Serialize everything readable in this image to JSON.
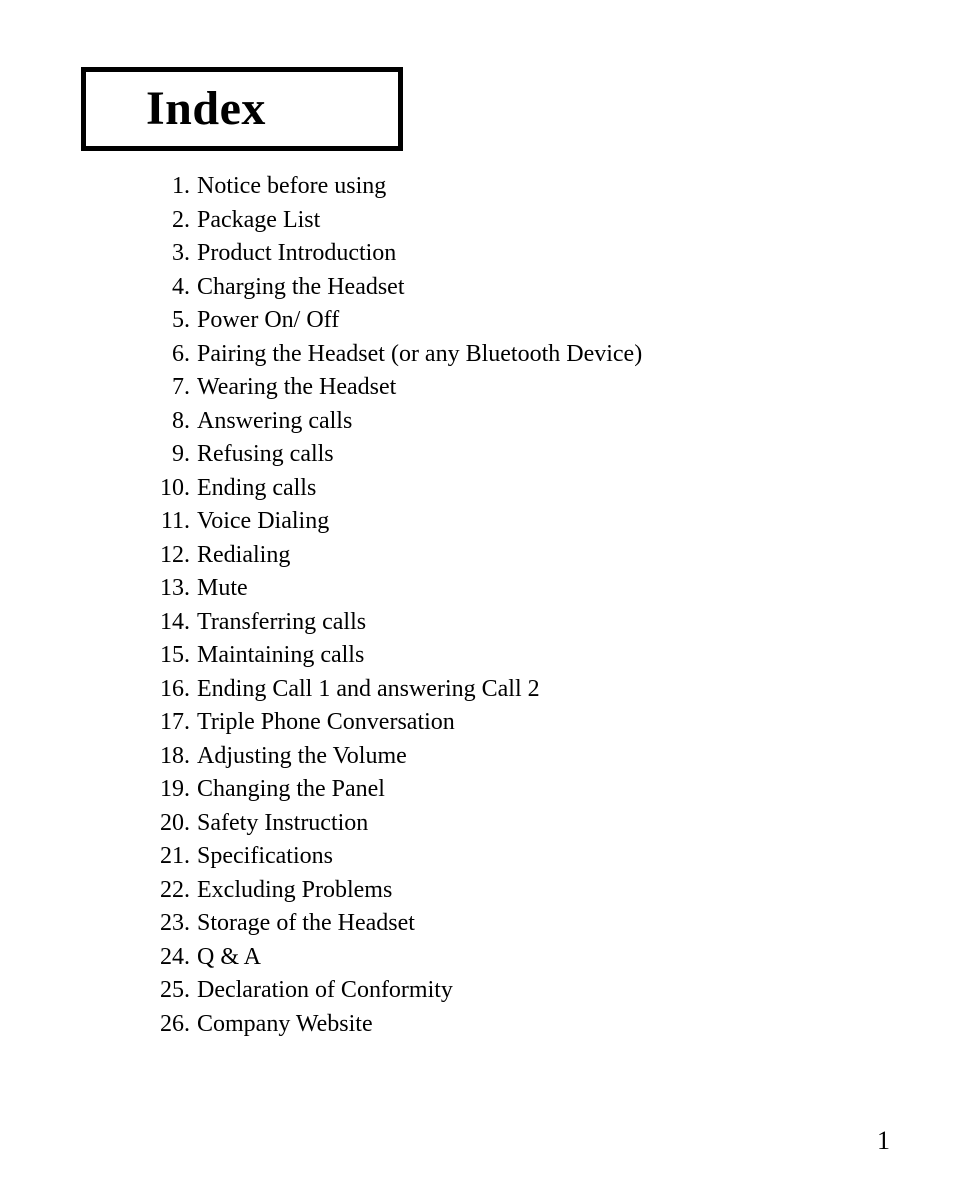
{
  "document": {
    "title": "Index",
    "page_number": "1",
    "background_color": "#ffffff",
    "text_color": "#000000"
  },
  "index": {
    "items": [
      {
        "number": "1.",
        "label": "Notice before using"
      },
      {
        "number": "2.",
        "label": "Package List"
      },
      {
        "number": "3.",
        "label": "Product Introduction"
      },
      {
        "number": "4.",
        "label": "Charging the Headset"
      },
      {
        "number": "5.",
        "label": "Power On/ Off"
      },
      {
        "number": "6.",
        "label": "Pairing the Headset (or any Bluetooth Device)"
      },
      {
        "number": "7.",
        "label": "Wearing the Headset"
      },
      {
        "number": "8.",
        "label": "Answering calls"
      },
      {
        "number": "9.",
        "label": "Refusing calls"
      },
      {
        "number": "10.",
        "label": "Ending calls"
      },
      {
        "number": "11.",
        "label": "Voice Dialing"
      },
      {
        "number": "12.",
        "label": "Redialing"
      },
      {
        "number": "13.",
        "label": "Mute"
      },
      {
        "number": "14.",
        "label": "Transferring calls"
      },
      {
        "number": "15.",
        "label": "Maintaining calls"
      },
      {
        "number": "16.",
        "label": "Ending Call 1 and answering Call 2"
      },
      {
        "number": "17.",
        "label": "Triple Phone Conversation"
      },
      {
        "number": "18.",
        "label": "Adjusting the Volume"
      },
      {
        "number": "19.",
        "label": "Changing the Panel"
      },
      {
        "number": "20.",
        "label": "Safety Instruction"
      },
      {
        "number": "21.",
        "label": "Specifications"
      },
      {
        "number": "22.",
        "label": "Excluding Problems"
      },
      {
        "number": "23.",
        "label": "Storage of the Headset"
      },
      {
        "number": "24.",
        "label": "Q & A"
      },
      {
        "number": "25.",
        "label": "Declaration of Conformity"
      },
      {
        "number": "26.",
        "label": "Company Website"
      }
    ]
  }
}
